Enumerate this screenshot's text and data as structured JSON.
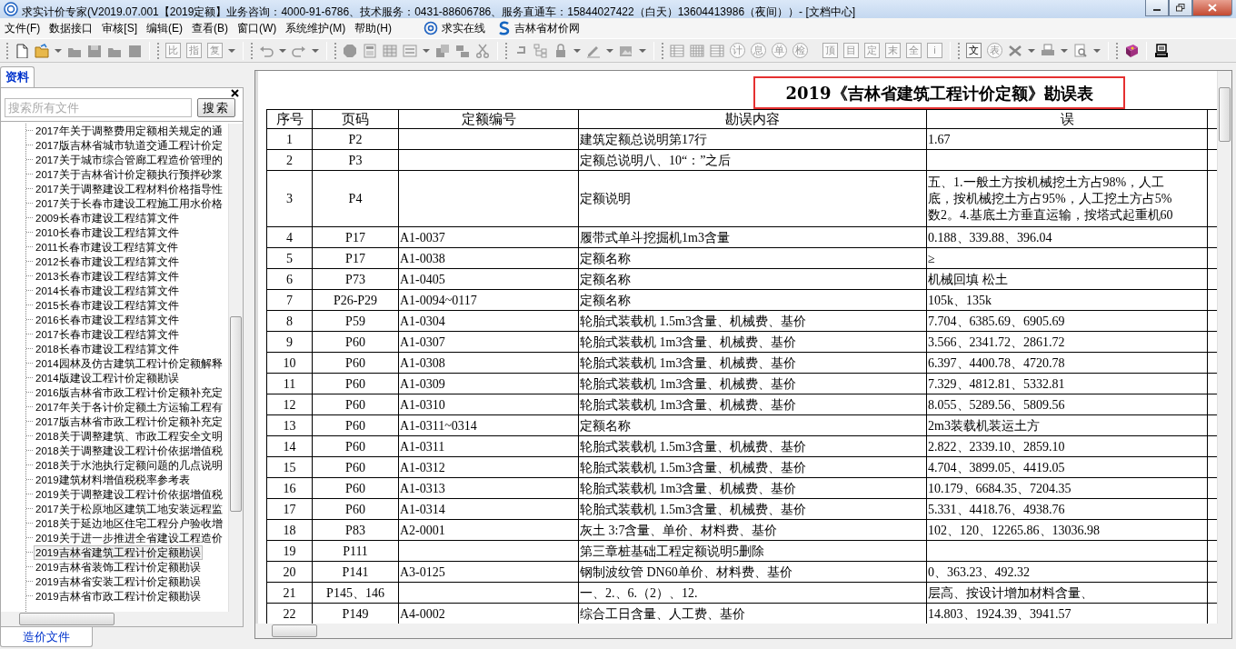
{
  "window": {
    "title": "求实计价专家(V2019.07.001【2019定额】业务咨询：4000-91-6786、技术服务：0431-88606786、服务直通车：15844027422（白天）13604413986（夜间））- [文档中心]"
  },
  "menu": [
    "文件(F)",
    "数据接口",
    "审核[S]",
    "编辑(E)",
    "查看(B)",
    "窗口(W)",
    "系统维护(M)",
    "帮助(H)"
  ],
  "menu_links": [
    "求实在线",
    "吉林省材价网"
  ],
  "toolbar": [
    {
      "kind": "square",
      "text": "比",
      "disabled": true
    },
    {
      "kind": "square",
      "text": "指",
      "disabled": true
    },
    {
      "kind": "square",
      "text": "复",
      "disabled": true
    },
    {
      "kind": "circle",
      "text": "计",
      "disabled": true
    },
    {
      "kind": "circle",
      "text": "息",
      "disabled": true
    },
    {
      "kind": "circle",
      "text": "单",
      "disabled": true
    },
    {
      "kind": "circle",
      "text": "检",
      "disabled": true
    },
    {
      "kind": "square",
      "text": "顶",
      "disabled": true
    },
    {
      "kind": "square",
      "text": "目",
      "disabled": true
    },
    {
      "kind": "square",
      "text": "定",
      "disabled": true
    },
    {
      "kind": "square",
      "text": "末",
      "disabled": true
    },
    {
      "kind": "square",
      "text": "全",
      "disabled": true
    },
    {
      "kind": "square",
      "text": "i",
      "disabled": true
    },
    {
      "kind": "square",
      "text": "文",
      "disabled": false
    },
    {
      "kind": "circle",
      "text": "表",
      "disabled": true
    }
  ],
  "left_panel": {
    "tabs": [
      {
        "label": "资料",
        "selected": true
      }
    ],
    "search": {
      "placeholder": "搜索所有文件",
      "button": "搜索"
    },
    "tree": {
      "items": [
        {
          "label": "2017年关于调整费用定额相关规定的通",
          "selected": false
        },
        {
          "label": "2017版吉林省城市轨道交通工程计价定",
          "selected": false
        },
        {
          "label": "2017关于城市综合管廊工程造价管理的",
          "selected": false
        },
        {
          "label": "2017关于吉林省计价定额执行预拌砂浆",
          "selected": false
        },
        {
          "label": "2017关于调整建设工程材料价格指导性",
          "selected": false
        },
        {
          "label": "2017关于长春市建设工程施工用水价格",
          "selected": false
        },
        {
          "label": "2009长春市建设工程结算文件",
          "selected": false
        },
        {
          "label": "2010长春市建设工程结算文件",
          "selected": false
        },
        {
          "label": "2011长春市建设工程结算文件",
          "selected": false
        },
        {
          "label": "2012长春市建设工程结算文件",
          "selected": false
        },
        {
          "label": "2013长春市建设工程结算文件",
          "selected": false
        },
        {
          "label": "2014长春市建设工程结算文件",
          "selected": false
        },
        {
          "label": "2015长春市建设工程结算文件",
          "selected": false
        },
        {
          "label": "2016长春市建设工程结算文件",
          "selected": false
        },
        {
          "label": "2017长春市建设工程结算文件",
          "selected": false
        },
        {
          "label": "2018长春市建设工程结算文件",
          "selected": false
        },
        {
          "label": "2014园林及仿古建筑工程计价定额解释",
          "selected": false
        },
        {
          "label": "2014版建设工程计价定额勘误",
          "selected": false
        },
        {
          "label": "2016版吉林省市政工程计价定额补充定",
          "selected": false
        },
        {
          "label": "2017年关于各计价定额土方运输工程有",
          "selected": false
        },
        {
          "label": "2017版吉林省市政工程计价定额补充定",
          "selected": false
        },
        {
          "label": "2018关于调整建筑、市政工程安全文明",
          "selected": false
        },
        {
          "label": "2018关于调整建设工程计价依据增值税",
          "selected": false
        },
        {
          "label": "2018关于水池执行定额问题的几点说明",
          "selected": false
        },
        {
          "label": "2019建筑材料增值税税率参考表",
          "selected": false
        },
        {
          "label": "2019关于调整建设工程计价依据增值税",
          "selected": false
        },
        {
          "label": "2017关于松原地区建筑工地安装远程监",
          "selected": false
        },
        {
          "label": "2018关于延边地区住宅工程分户验收增",
          "selected": false
        },
        {
          "label": "2019关于进一步推进全省建设工程造价",
          "selected": false
        },
        {
          "label": "2019吉林省建筑工程计价定额勘误",
          "selected": true
        },
        {
          "label": "2019吉林省装饰工程计价定额勘误",
          "selected": false
        },
        {
          "label": "2019吉林省安装工程计价定额勘误",
          "selected": false
        },
        {
          "label": "2019吉林省市政工程计价定额勘误",
          "selected": false
        }
      ]
    },
    "bottom_tabs": [
      {
        "label": "造价文件",
        "selected": true
      }
    ]
  },
  "document": {
    "title": "2019《吉林省建筑工程计价定额》勘误表",
    "table": {
      "columns": [
        "序号",
        "页码",
        "定额编号",
        "勘误内容",
        "误"
      ],
      "rows": [
        {
          "no": "1",
          "page": "P2",
          "content": "建筑定额总说明第17行",
          "error": "1.67"
        },
        {
          "no": "2",
          "page": "P3",
          "content": "定额总说明八、10“：”之后"
        },
        {
          "no": "3",
          "page": "P4",
          "content": "定额说明",
          "error_lines": [
            "五、1.一般土方按机械挖土方占98%，人工",
            "底，按机械挖土方占95%，人工挖土方占5%",
            "数2。4.基底土方垂直运输，按塔式起重机60"
          ]
        },
        {
          "no": "4",
          "page": "P17",
          "code": "A1-0037",
          "content": "履带式单斗挖掘机1m3含量",
          "error": "0.188、339.88、396.04"
        },
        {
          "no": "5",
          "page": "P17",
          "code": "A1-0038",
          "content": "定额名称",
          "error": "≥"
        },
        {
          "no": "6",
          "page": "P73",
          "code": "A1-0405",
          "content": "定额名称",
          "error": "机械回填 松土"
        },
        {
          "no": "7",
          "page": "P26-P29",
          "code": "A1-0094~0117",
          "content": "定额名称",
          "error": "105k、135k"
        },
        {
          "no": "8",
          "page": "P59",
          "code": "A1-0304",
          "content": "轮胎式装载机 1.5m3含量、机械费、基价",
          "error": "7.704、6385.69、6905.69"
        },
        {
          "no": "9",
          "page": "P60",
          "code": "A1-0307",
          "content": "轮胎式装载机 1m3含量、机械费、基价",
          "error": "3.566、2341.72、2861.72"
        },
        {
          "no": "10",
          "page": "P60",
          "code": "A1-0308",
          "content": "轮胎式装载机 1m3含量、机械费、基价",
          "error": "6.397、4400.78、4720.78"
        },
        {
          "no": "11",
          "page": "P60",
          "code": "A1-0309",
          "content": "轮胎式装载机 1m3含量、机械费、基价",
          "error": "7.329、4812.81、5332.81"
        },
        {
          "no": "12",
          "page": "P60",
          "code": "A1-0310",
          "content": "轮胎式装载机 1m3含量、机械费、基价",
          "error": "8.055、5289.56、5809.56"
        },
        {
          "no": "13",
          "page": "P60",
          "code": "A1-0311~0314",
          "content": "定额名称",
          "error": "2m3装载机装运土方"
        },
        {
          "no": "14",
          "page": "P60",
          "code": "A1-0311",
          "content": "轮胎式装载机 1.5m3含量、机械费、基价",
          "error": "2.822、2339.10、2859.10"
        },
        {
          "no": "15",
          "page": "P60",
          "code": "A1-0312",
          "content": "轮胎式装载机 1.5m3含量、机械费、基价",
          "error": "4.704、3899.05、4419.05"
        },
        {
          "no": "16",
          "page": "P60",
          "code": "A1-0313",
          "content": "轮胎式装载机 1m3含量、机械费、基价",
          "error": "10.179、6684.35、7204.35"
        },
        {
          "no": "17",
          "page": "P60",
          "code": "A1-0314",
          "content": "轮胎式装载机 1.5m3含量、机械费、基价",
          "error": "5.331、4418.76、4938.76"
        },
        {
          "no": "18",
          "page": "P83",
          "code": "A2-0001",
          "content": "灰土 3:7含量、单价、材料费、基价",
          "error": "102、120、12265.86、13036.98"
        },
        {
          "no": "19",
          "page": "P111",
          "content": "第三章桩基础工程定额说明5删除"
        },
        {
          "no": "20",
          "page": "P141",
          "code": "A3-0125",
          "content": "钢制波纹管 DN60单价、材料费、基价",
          "error": "0、363.23、492.32"
        },
        {
          "no": "21",
          "page": "P145、146",
          "content": "一、2.、6.（2）、12.",
          "error": "层高、按设计增加材料含量、"
        },
        {
          "no": "22",
          "page": "P149",
          "code": "A4-0002",
          "content": "综合工日含量、人工费、基价",
          "error": "14.803、1924.39、3941.57"
        }
      ]
    }
  }
}
